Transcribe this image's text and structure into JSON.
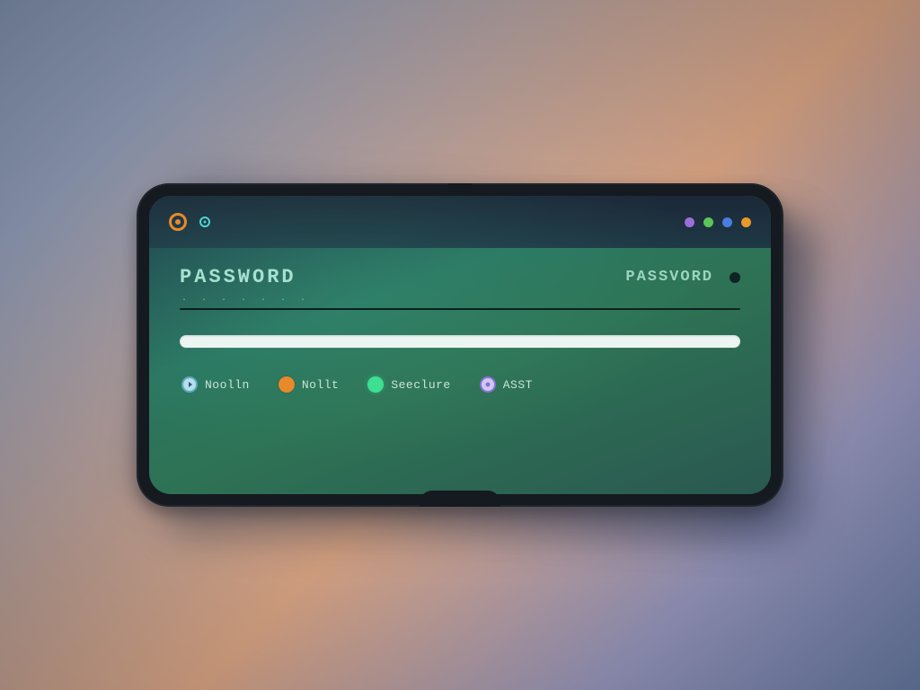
{
  "statusbar": {
    "left_icons": [
      "ring-orange",
      "ring-small-teal"
    ],
    "right_dots": [
      "purple",
      "green",
      "blue",
      "orange"
    ]
  },
  "password": {
    "label_primary": "PASSWORD",
    "label_secondary": "PASSVORD",
    "masked_value": ". . . . . . ."
  },
  "options": [
    {
      "icon": "play-circle",
      "color": "light-blue",
      "label": "Noolln"
    },
    {
      "icon": "dot",
      "color": "orange",
      "label": "Nollt"
    },
    {
      "icon": "dot",
      "color": "green",
      "label": "Seeclure"
    },
    {
      "icon": "radio",
      "color": "purple",
      "label": "ASST"
    }
  ],
  "colors": {
    "accent_orange": "#e8892a",
    "accent_teal": "#4dd5d5",
    "accent_green": "#3de090",
    "accent_purple": "#8a70d8",
    "screen_bg_start": "#1d3a4a",
    "screen_bg_end": "#2a5850"
  }
}
